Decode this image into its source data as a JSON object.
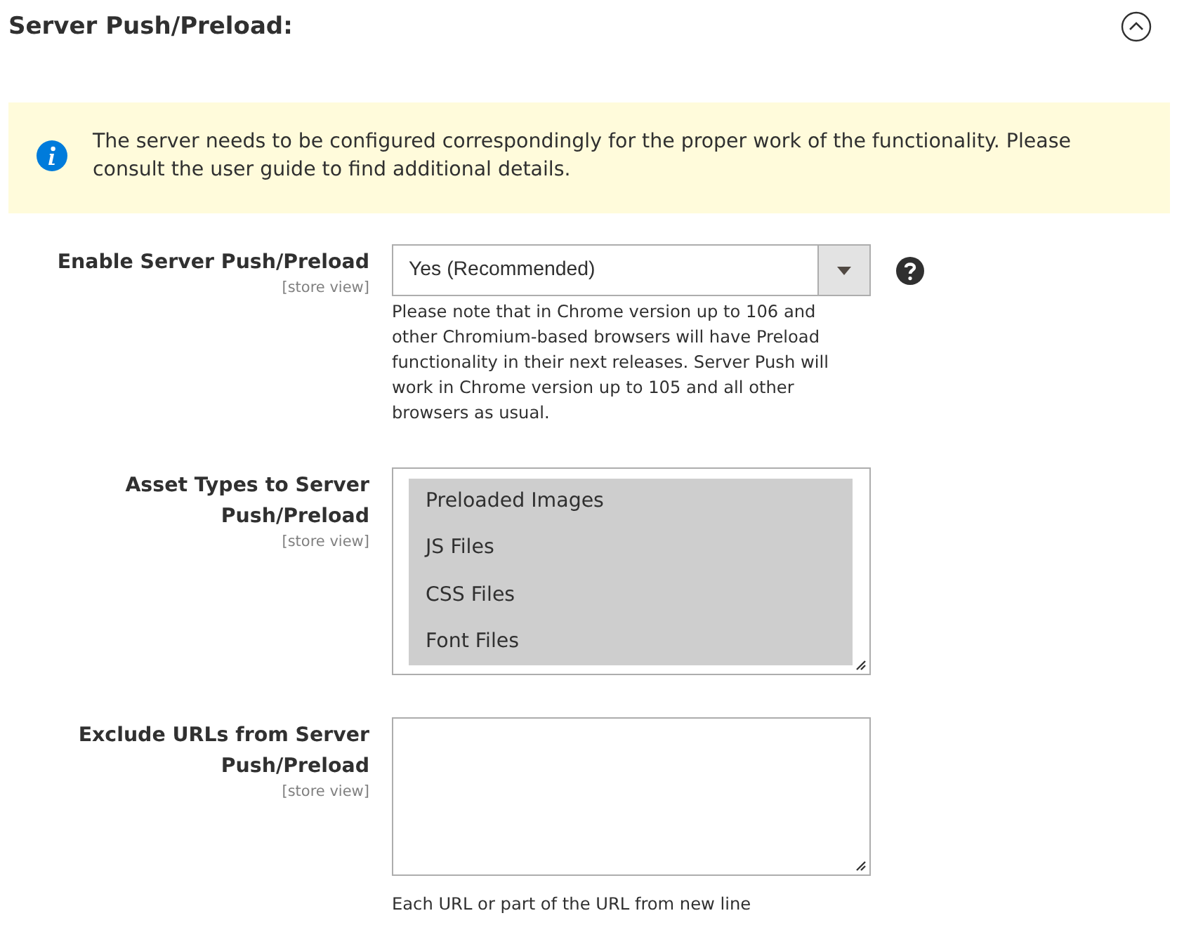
{
  "section": {
    "title": "Server Push/Preload:",
    "expanded": true
  },
  "notice": {
    "text": "The server needs to be configured correspondingly for the proper work of the functionality. Please consult the user guide to find additional details."
  },
  "fields": [
    {
      "kind": "select",
      "label": "Enable Server Push/Preload",
      "scope": "[store view]",
      "value": "Yes (Recommended)",
      "help": true,
      "note": "Please note that in Chrome version up to 106 and other Chromium-based browsers will have Preload functionality in their next releases. Server Push will work in Chrome version up to 105 and all other browsers as usual."
    },
    {
      "kind": "multiselect",
      "label": "Asset Types to Server Push/Preload",
      "scope": "[store view]",
      "options": [
        {
          "label": "Preloaded Images",
          "selected": true
        },
        {
          "label": "JS Files",
          "selected": true
        },
        {
          "label": "CSS Files",
          "selected": true
        },
        {
          "label": "Font Files",
          "selected": true
        }
      ]
    },
    {
      "kind": "textarea",
      "label": "Exclude URLs from Server Push/Preload",
      "scope": "[store view]",
      "note": "Each URL or part of the URL from new line"
    }
  ]
}
